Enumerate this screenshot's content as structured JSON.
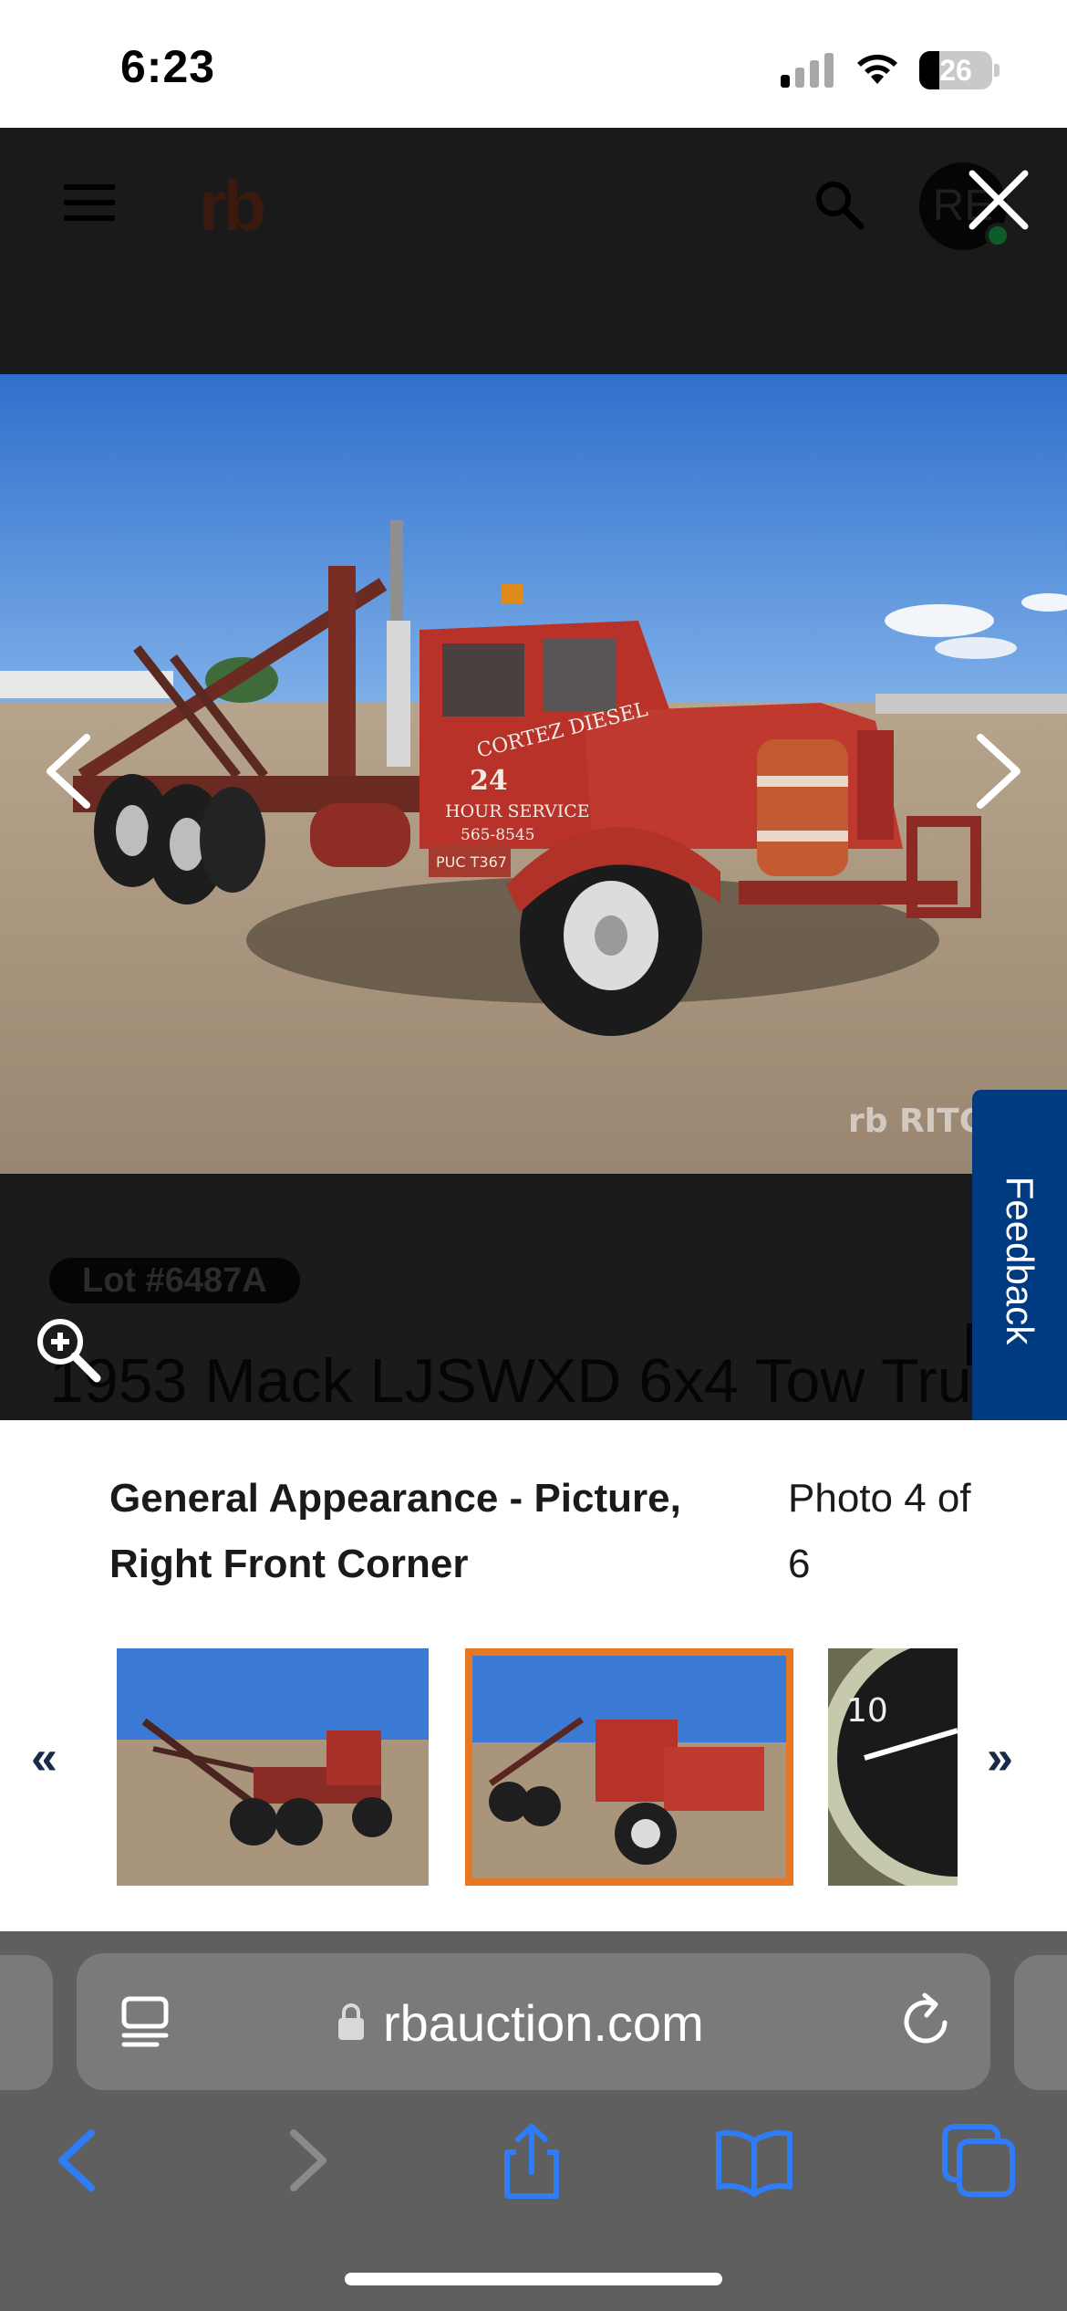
{
  "status_bar": {
    "time": "6:23",
    "battery_level": "26"
  },
  "site_header": {
    "logo_text": "rb",
    "avatar_initials": "RE"
  },
  "lightbox": {
    "lot_badge": "Lot #6487A",
    "listing_title": "1953 Mack LJSWXD 6x4 Tow Truck",
    "caption_title": "General Appearance - Picture, Right Front Corner",
    "photo_counter": "Photo 4 of 6",
    "watermark": "rb RITCHIE",
    "truck_door_lettering": [
      "CORTEZ DIESEL",
      "24",
      "HOUR SERVICE",
      "565-8545"
    ],
    "truck_plate": "PUC T367",
    "prev_thumbs_label": "«",
    "next_thumbs_label": "»",
    "thumbnails": [
      {
        "name": "left-side-tow-truck",
        "selected": false
      },
      {
        "name": "right-front-corner",
        "selected": true
      },
      {
        "name": "gauge-closeup",
        "selected": false,
        "gauge_reading": "10"
      }
    ]
  },
  "feedback": {
    "label": "Feedback"
  },
  "browser": {
    "url": "rbauction.com"
  },
  "colors": {
    "feedback_blue": "#003a80",
    "selected_thumb_border": "#e87722",
    "safari_blue": "#2e7cf6",
    "truck_red": "#b8322a"
  }
}
